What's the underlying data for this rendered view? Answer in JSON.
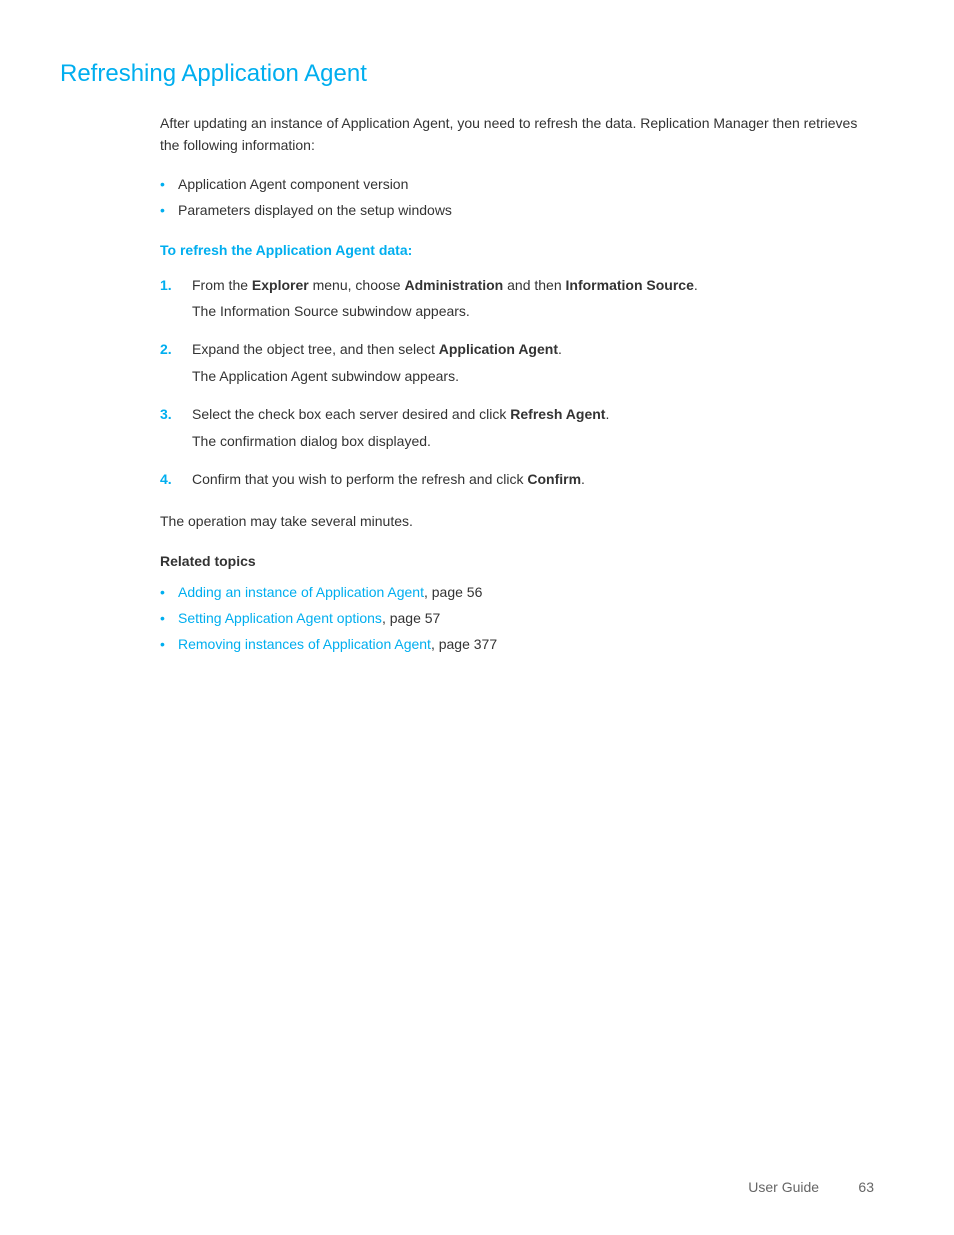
{
  "page": {
    "title": "Refreshing Application Agent",
    "intro_paragraph": "After updating an instance of Application Agent, you need to refresh the data. Replication Manager then retrieves the following information:",
    "bullet_items": [
      "Application Agent component version",
      "Parameters displayed on the setup windows"
    ],
    "procedure_heading": "To refresh the Application Agent data:",
    "steps": [
      {
        "number": "1.",
        "text_parts": [
          {
            "text": "From the ",
            "bold": false
          },
          {
            "text": "Explorer",
            "bold": true
          },
          {
            "text": " menu, choose ",
            "bold": false
          },
          {
            "text": "Administration",
            "bold": true
          },
          {
            "text": " and then ",
            "bold": false
          },
          {
            "text": "Information Source",
            "bold": true
          },
          {
            "text": ".",
            "bold": false
          }
        ],
        "sub_text": "The Information Source subwindow appears."
      },
      {
        "number": "2.",
        "text_parts": [
          {
            "text": "Expand the object tree, and then select ",
            "bold": false
          },
          {
            "text": "Application Agent",
            "bold": true
          },
          {
            "text": ".",
            "bold": false
          }
        ],
        "sub_text": "The Application Agent subwindow appears."
      },
      {
        "number": "3.",
        "text_parts": [
          {
            "text": "Select the check box each server desired and click ",
            "bold": false
          },
          {
            "text": "Refresh Agent",
            "bold": true
          },
          {
            "text": ".",
            "bold": false
          }
        ],
        "sub_text": "The confirmation dialog box displayed."
      },
      {
        "number": "4.",
        "text_parts": [
          {
            "text": "Confirm that you wish to perform the refresh and click ",
            "bold": false
          },
          {
            "text": "Confirm",
            "bold": true
          },
          {
            "text": ".",
            "bold": false
          }
        ],
        "sub_text": ""
      }
    ],
    "operation_text": "The operation may take several minutes.",
    "related_topics_heading": "Related topics",
    "related_links": [
      {
        "link_text": "Adding an instance of Application Agent",
        "page_text": ", page 56"
      },
      {
        "link_text": "Setting Application Agent options",
        "page_text": ", page 57"
      },
      {
        "link_text": "Removing instances of Application Agent",
        "page_text": ", page 377"
      }
    ],
    "footer": {
      "label": "User Guide",
      "page_number": "63"
    }
  }
}
